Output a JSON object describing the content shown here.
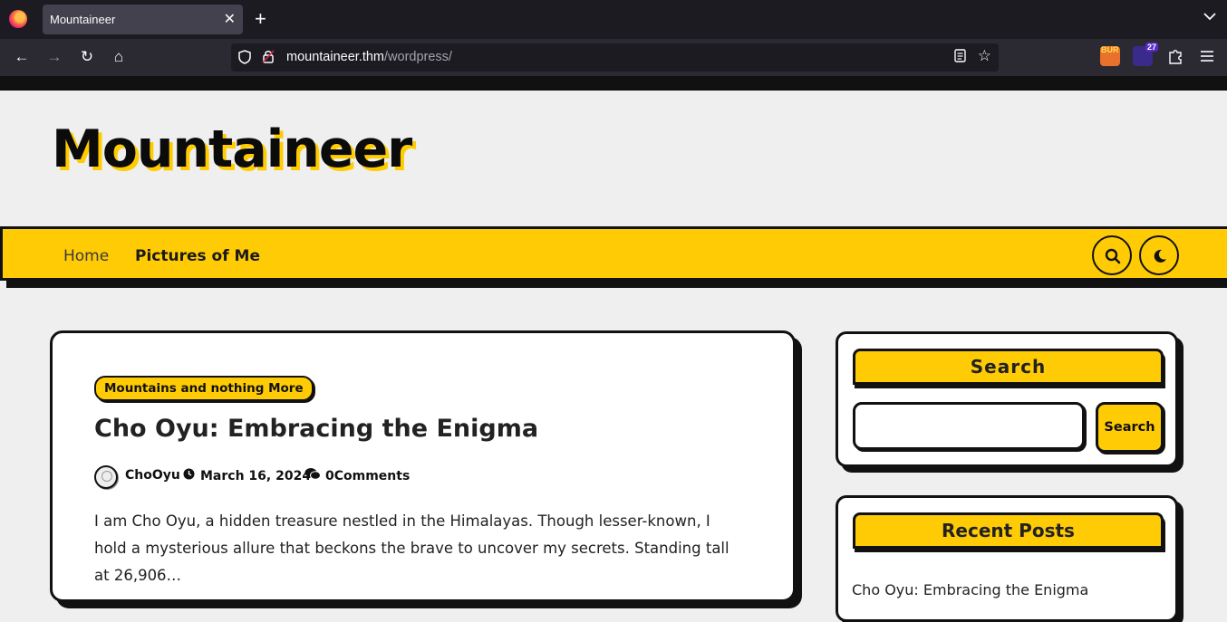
{
  "browser": {
    "tab_title": "Mountaineer",
    "url_host": "mountaineer.thm",
    "url_path": "/wordpress/",
    "ext_burp_label": "BUR",
    "ext_badge_count": "27"
  },
  "site": {
    "title": "Mountaineer",
    "menu": [
      {
        "label": "Home"
      },
      {
        "label": "Pictures of Me"
      }
    ]
  },
  "post": {
    "category": "Mountains and nothing More",
    "title": "Cho Oyu: Embracing the Enigma",
    "author": "ChoOyu",
    "date": "March 16, 2024",
    "comments": "0Comments",
    "excerpt": "I am Cho Oyu, a hidden treasure nestled in the Himalayas. Though lesser-known, I hold a mysterious allure that beckons the brave to uncover my secrets. Standing tall at 26,906…"
  },
  "sidebar": {
    "search_title": "Search",
    "search_button": "Search",
    "search_placeholder": "",
    "recent_title": "Recent Posts",
    "recent_posts": [
      "Cho Oyu: Embracing the Enigma"
    ]
  },
  "colors": {
    "accent": "#ffcb05",
    "ink": "#111111",
    "page_bg": "#efefef"
  }
}
